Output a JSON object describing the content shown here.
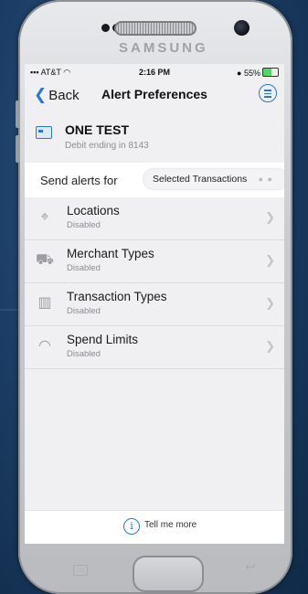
{
  "device": {
    "brand": "SAMSUNG"
  },
  "status_bar": {
    "carrier": "AT&T",
    "time": "2:16 PM",
    "battery": "55%"
  },
  "nav": {
    "back_label": "Back",
    "title": "Alert Preferences",
    "menu_icon": "menu-lines-icon"
  },
  "account": {
    "name": "ONE TEST",
    "subtitle": "Debit ending in 8143",
    "icon": "card-icon"
  },
  "send_alerts": {
    "label": "Send alerts for",
    "selected": "Selected Transactions"
  },
  "alert_types": [
    {
      "title": "Locations",
      "status": "Disabled",
      "icon": "map-pin-icon"
    },
    {
      "title": "Merchant Types",
      "status": "Disabled",
      "icon": "shopping-cart-icon"
    },
    {
      "title": "Transaction Types",
      "status": "Disabled",
      "icon": "building-icon"
    },
    {
      "title": "Spend Limits",
      "status": "Disabled",
      "icon": "speedometer-icon"
    }
  ],
  "footer": {
    "label": "Tell me more"
  },
  "colors": {
    "accent": "#2a77d6",
    "background": "#f0f0f2"
  }
}
